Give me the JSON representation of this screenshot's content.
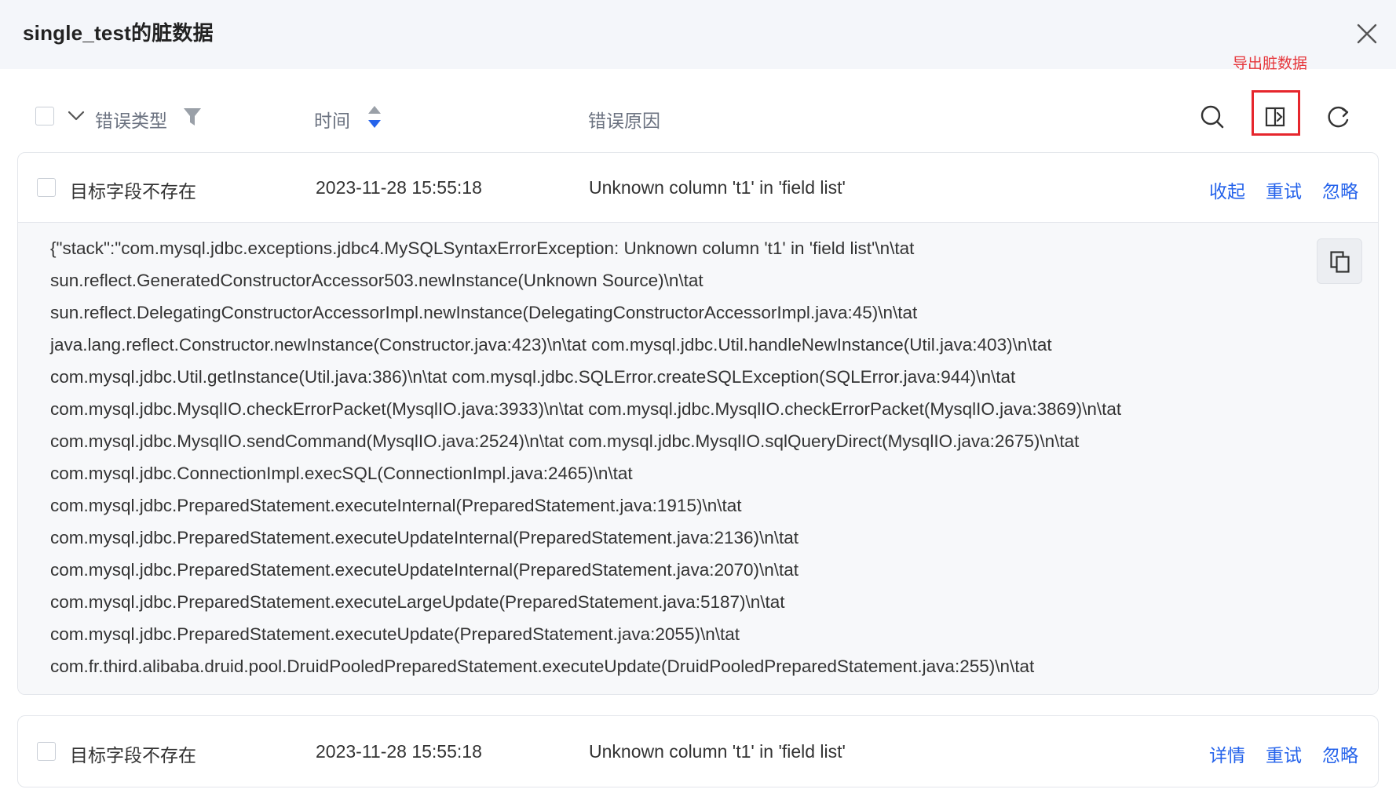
{
  "dialog": {
    "title": "single_test的脏数据",
    "close_icon": "close-icon"
  },
  "toolbar": {
    "export_tooltip": "导出脏数据",
    "columns": {
      "error_type": "错误类型",
      "time": "时间",
      "error_reason": "错误原因"
    },
    "icons": [
      "chevron-down-icon",
      "filter-icon",
      "sort-icon",
      "search-icon",
      "export-icon",
      "refresh-icon"
    ]
  },
  "rows": [
    {
      "type": "目标字段不存在",
      "time": "2023-11-28 15:55:18",
      "reason": "Unknown column 't1' in 'field list'",
      "actions": [
        "收起",
        "重试",
        "忽略"
      ],
      "expanded": true,
      "stack_lines": [
        "{\"stack\":\"com.mysql.jdbc.exceptions.jdbc4.MySQLSyntaxErrorException: Unknown column 't1' in 'field list'\\n\\tat",
        "sun.reflect.GeneratedConstructorAccessor503.newInstance(Unknown Source)\\n\\tat",
        "sun.reflect.DelegatingConstructorAccessorImpl.newInstance(DelegatingConstructorAccessorImpl.java:45)\\n\\tat",
        "java.lang.reflect.Constructor.newInstance(Constructor.java:423)\\n\\tat com.mysql.jdbc.Util.handleNewInstance(Util.java:403)\\n\\tat",
        "com.mysql.jdbc.Util.getInstance(Util.java:386)\\n\\tat com.mysql.jdbc.SQLError.createSQLException(SQLError.java:944)\\n\\tat",
        "com.mysql.jdbc.MysqlIO.checkErrorPacket(MysqlIO.java:3933)\\n\\tat com.mysql.jdbc.MysqlIO.checkErrorPacket(MysqlIO.java:3869)\\n\\tat",
        "com.mysql.jdbc.MysqlIO.sendCommand(MysqlIO.java:2524)\\n\\tat com.mysql.jdbc.MysqlIO.sqlQueryDirect(MysqlIO.java:2675)\\n\\tat",
        "com.mysql.jdbc.ConnectionImpl.execSQL(ConnectionImpl.java:2465)\\n\\tat",
        "com.mysql.jdbc.PreparedStatement.executeInternal(PreparedStatement.java:1915)\\n\\tat",
        "com.mysql.jdbc.PreparedStatement.executeUpdateInternal(PreparedStatement.java:2136)\\n\\tat",
        "com.mysql.jdbc.PreparedStatement.executeUpdateInternal(PreparedStatement.java:2070)\\n\\tat",
        "com.mysql.jdbc.PreparedStatement.executeLargeUpdate(PreparedStatement.java:5187)\\n\\tat",
        "com.mysql.jdbc.PreparedStatement.executeUpdate(PreparedStatement.java:2055)\\n\\tat",
        "com.fr.third.alibaba.druid.pool.DruidPooledPreparedStatement.executeUpdate(DruidPooledPreparedStatement.java:255)\\n\\tat"
      ]
    },
    {
      "type": "目标字段不存在",
      "time": "2023-11-28 15:55:18",
      "reason": "Unknown column 't1' in 'field list'",
      "actions": [
        "详情",
        "重试",
        "忽略"
      ],
      "expanded": false
    }
  ],
  "colors": {
    "accent": "#2563eb",
    "highlight": "#e6262d",
    "header_bg": "#f4f6fa",
    "detail_bg": "#f7f8fa"
  }
}
